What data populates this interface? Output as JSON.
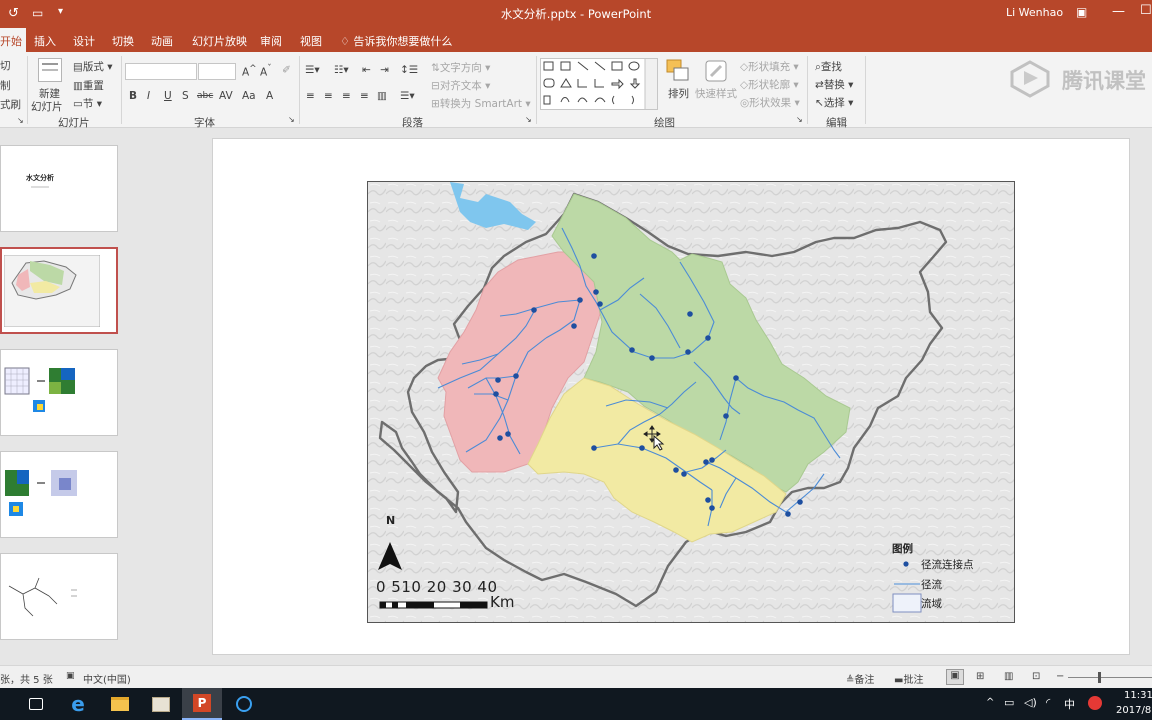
{
  "window": {
    "title": "水文分析.pptx - PowerPoint",
    "user": "Li Wenhao",
    "watermark": "腾讯课堂"
  },
  "tabs": [
    "开始",
    "插入",
    "设计",
    "切换",
    "动画",
    "幻灯片放映",
    "审阅",
    "视图"
  ],
  "tell_me": "告诉我你想要做什么",
  "ribbon": {
    "clipboard": {
      "cut": "切",
      "copy": "制",
      "painter": "式刷"
    },
    "slides": {
      "new_slide_1": "新建",
      "new_slide_2": "幻灯片",
      "layout": "版式",
      "reset": "重置",
      "section": "节",
      "group": "幻灯片"
    },
    "font": {
      "group": "字体"
    },
    "paragraph": {
      "text_direction": "文字方向",
      "align_text": "对齐文本",
      "smartart": "转换为 SmartArt",
      "group": "段落"
    },
    "drawing": {
      "arrange": "排列",
      "quick_styles": "快速样式",
      "shape_fill": "形状填充",
      "shape_outline": "形状轮廓",
      "shape_effects": "形状效果",
      "group": "绘图"
    },
    "editing": {
      "find": "查找",
      "replace": "替换",
      "select": "选择",
      "group": "编辑"
    }
  },
  "thumbnails": [
    {
      "title": "水文分析"
    },
    {
      "title": ""
    },
    {
      "title": ""
    },
    {
      "title": ""
    },
    {
      "title": ""
    }
  ],
  "slide": {
    "north": "N",
    "scale_numbers": "0 510  20  30  40",
    "scale_unit": "Km",
    "legend": {
      "title": "图例",
      "point": "径流连接点",
      "line": "径流",
      "area": "流域"
    }
  },
  "status": {
    "slide_count": "张，共 5 张",
    "language": "中文(中国)",
    "notes": "备注",
    "comments": "批注"
  },
  "taskbar": {
    "time": "11:31",
    "date": "2017/8",
    "ime": "中"
  },
  "colors": {
    "accent": "#b7472a",
    "basin_red": "#f0b7b9",
    "basin_green": "#bcd9a6",
    "basin_yellow": "#f2eaa3",
    "river": "#4b8bd6",
    "point": "#1e4fa0"
  }
}
